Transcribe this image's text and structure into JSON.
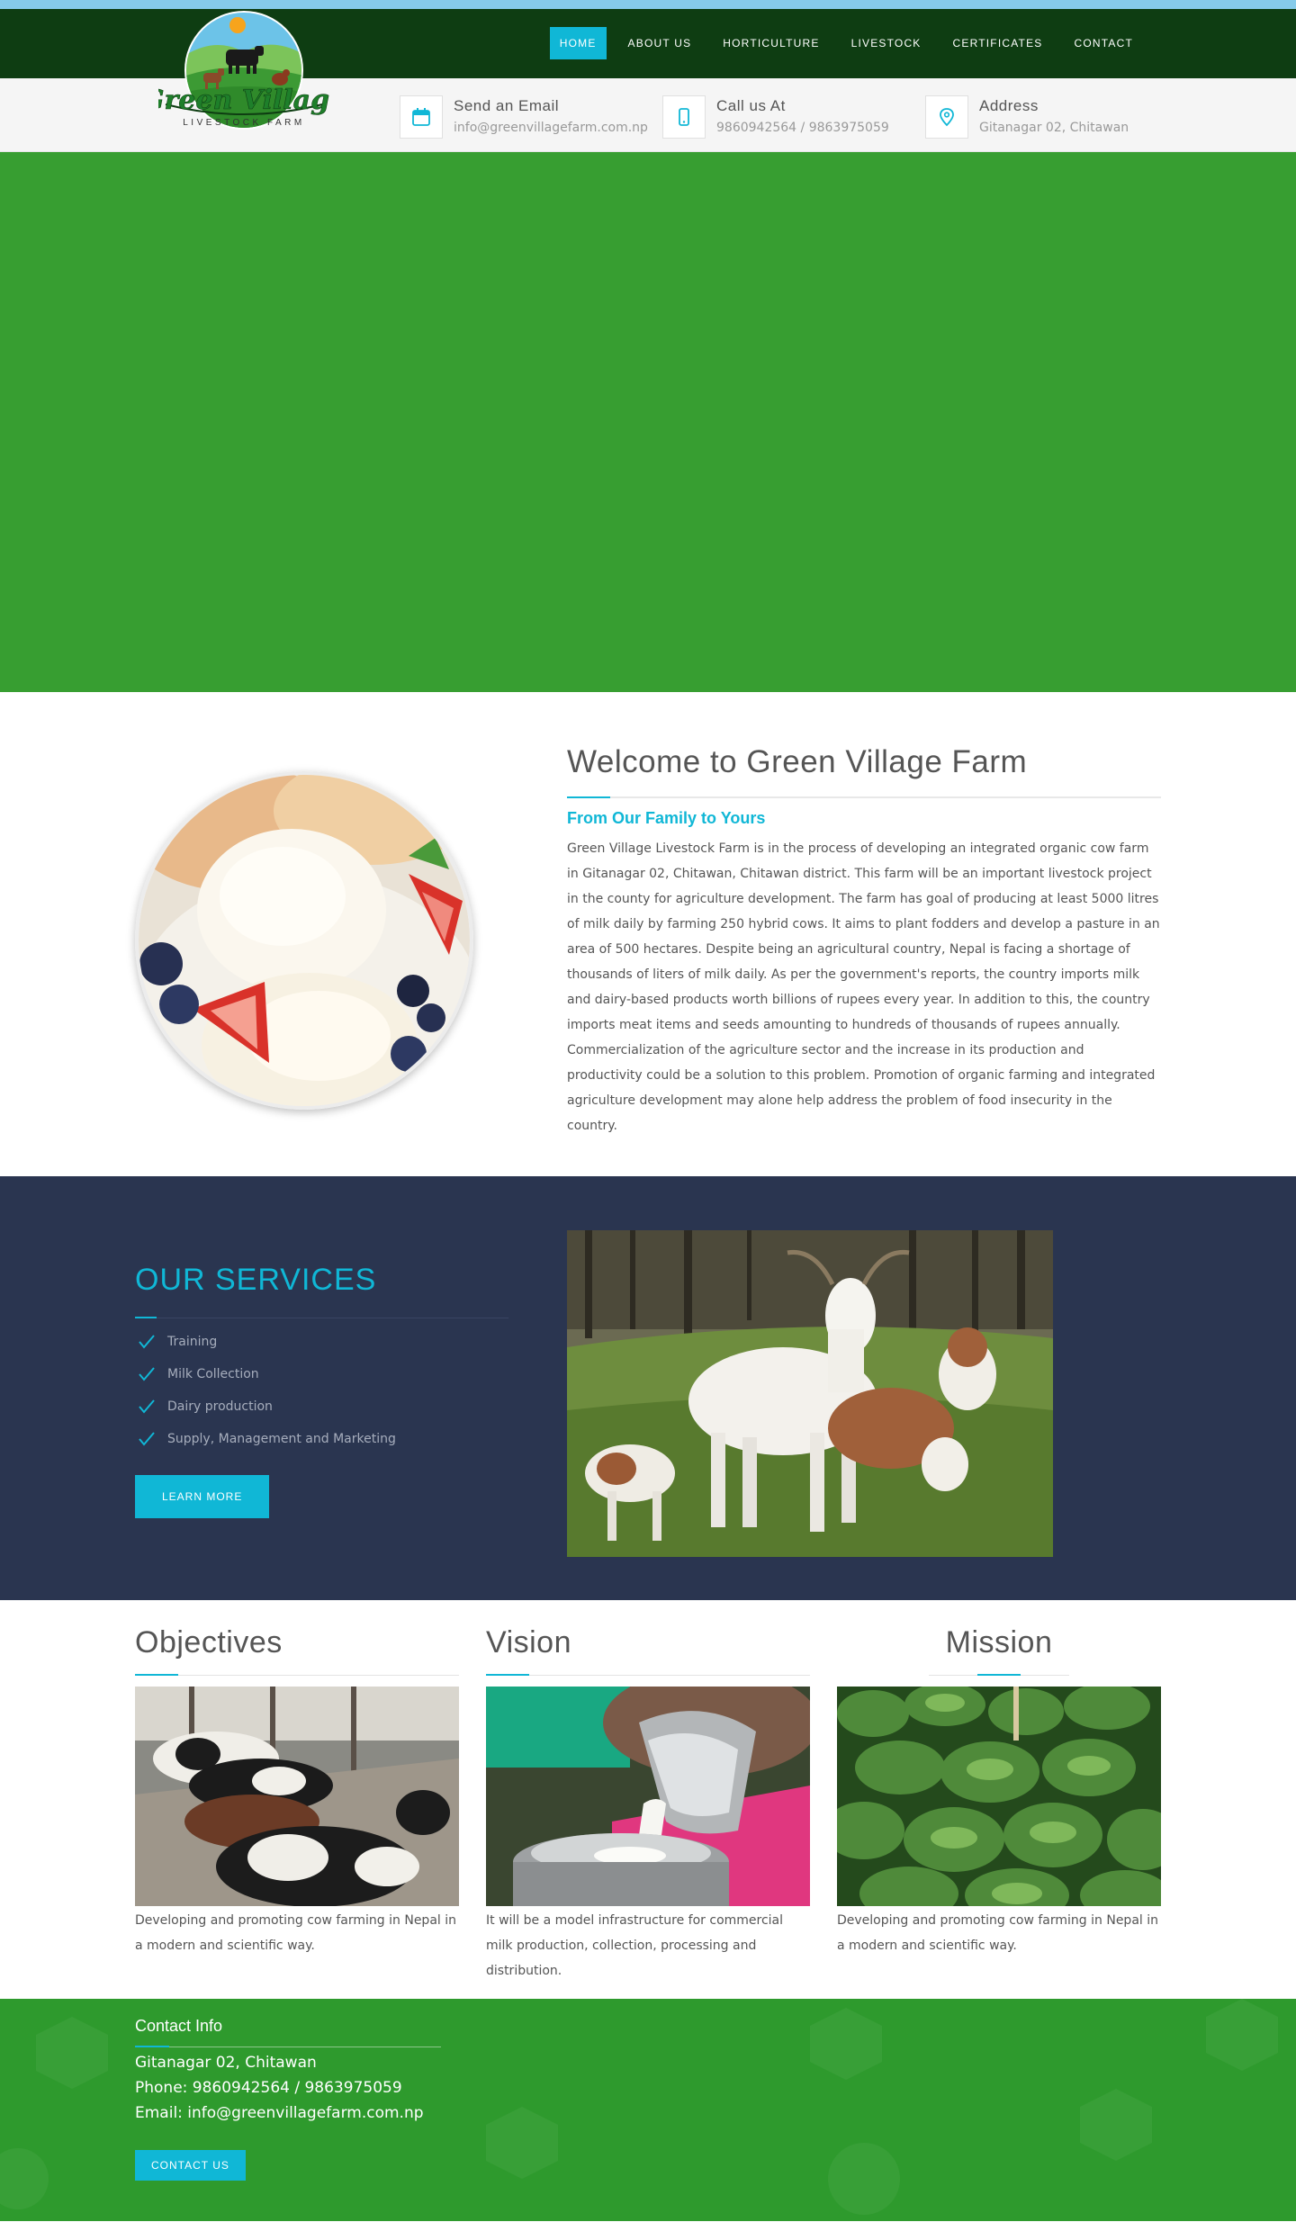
{
  "colors": {
    "accent": "#10b7d6",
    "nav_bg": "#0e3d12",
    "hero_bg": "#379e31",
    "services_bg": "#2a3550",
    "footer_bg": "#2e9a2d"
  },
  "logo": {
    "brand": "Green Village",
    "tagline": "LIVESTOCK FARM"
  },
  "nav": {
    "items": [
      {
        "label": "HOME",
        "active": true
      },
      {
        "label": "ABOUT US"
      },
      {
        "label": "HORTICULTURE"
      },
      {
        "label": "LIVESTOCK"
      },
      {
        "label": "CERTIFICATES"
      },
      {
        "label": "CONTACT"
      }
    ]
  },
  "contact_strip": {
    "email": {
      "icon": "calendar-icon",
      "title": "Send an Email",
      "value": "info@greenvillagefarm.com.np"
    },
    "phone": {
      "icon": "mobile-phone-icon",
      "title": "Call us At",
      "value": "9860942564 / 9863975059"
    },
    "address": {
      "icon": "location-pin-icon",
      "title": "Address",
      "value": "Gitanagar 02, Chitawan"
    }
  },
  "welcome": {
    "title": "Welcome to Green Village Farm",
    "subtitle": "From Our Family to Yours",
    "body": "Green Village Livestock Farm is in the process of developing an integrated organic cow farm in Gitanagar 02, Chitawan, Chitawan district. This farm will be an important livestock project in the county for agriculture development. The farm has goal of producing at least 5000 litres of milk daily by farming 250 hybrid cows. It aims to plant fodders and develop a pasture in an area of 500 hectares. Despite being an agricultural country, Nepal is facing a shortage of thousands of liters of milk daily. As per the government's reports, the country imports milk and dairy-based products worth billions of rupees every year. In addition to this, the country imports meat items and seeds amounting to hundreds of thousands of rupees annually. Commercialization of the agriculture sector and the increase in its production and productivity could be a solution to this problem. Promotion of organic farming and integrated agriculture development may alone help address the problem of food insecurity in the country."
  },
  "services": {
    "title": "OUR SERVICES",
    "items": [
      "Training",
      "Milk Collection",
      "Dairy production",
      "Supply, Management and Marketing"
    ],
    "button": "LEARN MORE"
  },
  "columns": [
    {
      "title": "Objectives",
      "text": "Developing and promoting cow farming in Nepal in a modern and scientific way."
    },
    {
      "title": "Vision",
      "text": "It will be a model infrastructure for commercial milk production, collection, processing and distribution."
    },
    {
      "title": "Mission",
      "text": "Developing and promoting cow farming in Nepal in a modern and scientific way."
    }
  ],
  "footer": {
    "title": "Contact Info",
    "address": "Gitanagar 02, Chitawan",
    "phone": "Phone: 9860942564 / 9863975059",
    "email": "Email: info@greenvillagefarm.com.np",
    "button": "CONTACT US"
  }
}
